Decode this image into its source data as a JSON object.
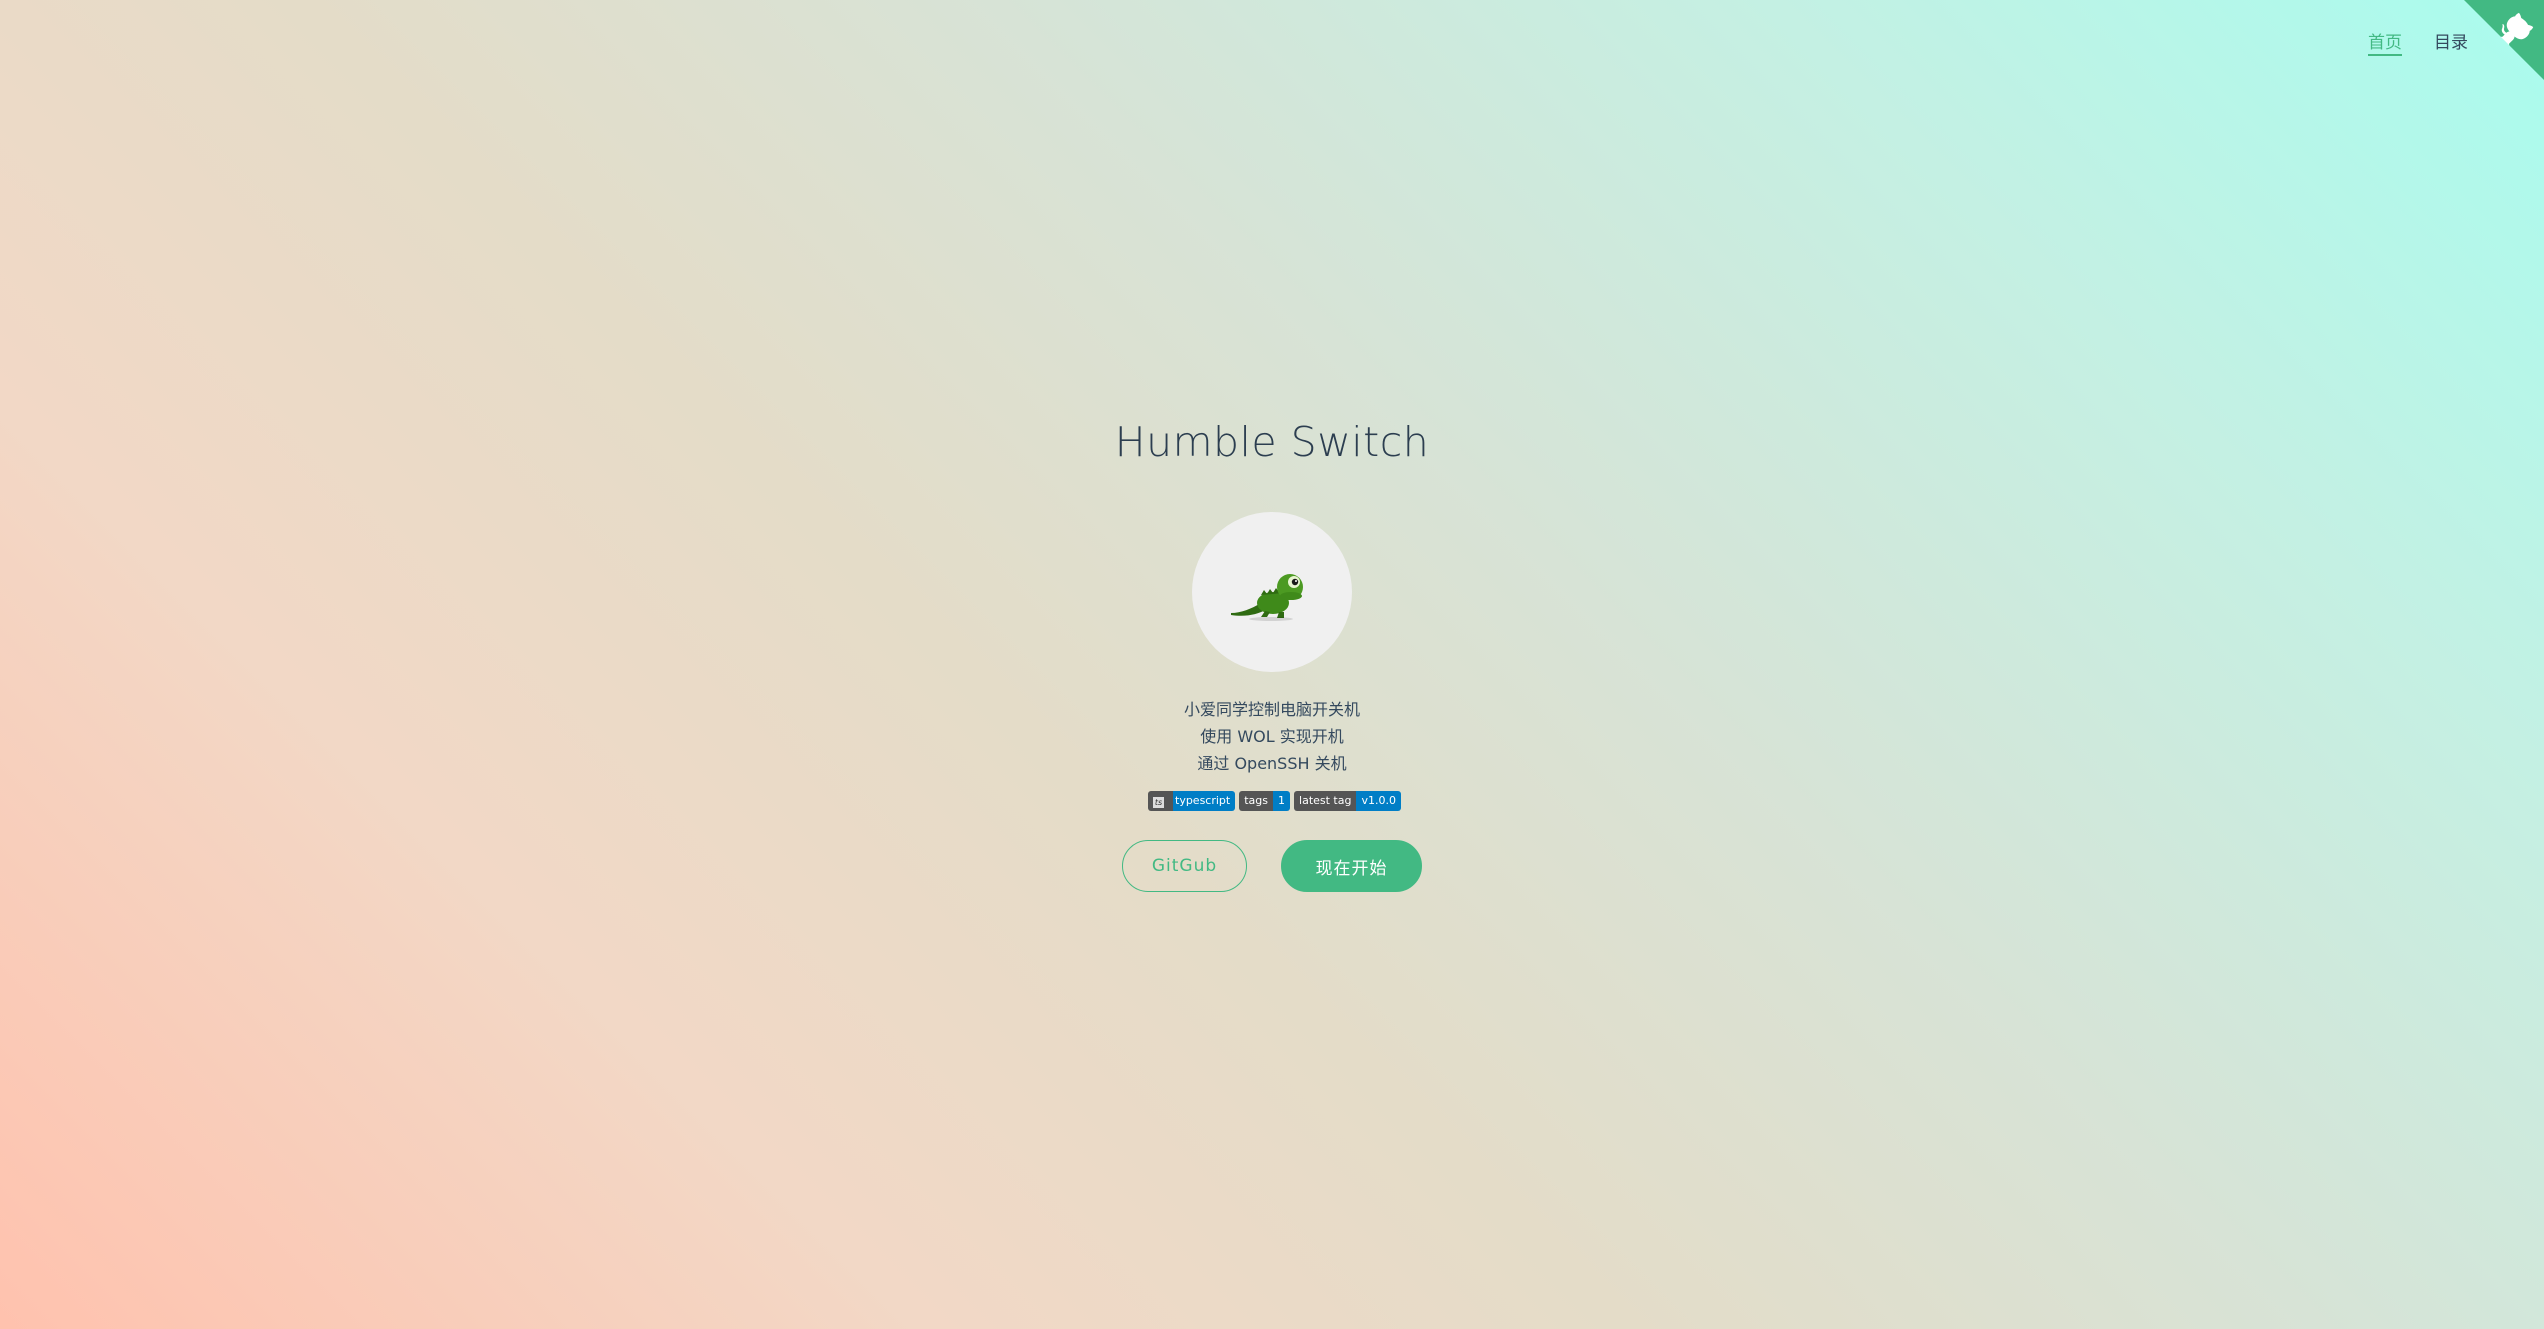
{
  "nav": {
    "items": [
      {
        "label": "首页",
        "active": true
      },
      {
        "label": "目录",
        "active": false
      }
    ]
  },
  "cover": {
    "title": "Humble Switch",
    "description": [
      "小爱同学控制电脑开关机",
      "使用 WOL 实现开机",
      "通过 OpenSSH 关机"
    ],
    "badges": [
      {
        "left": "",
        "right": "typescript",
        "left_icon": "typescript-icon"
      },
      {
        "left": "tags",
        "right": "1"
      },
      {
        "left": "latest tag",
        "right": "v1.0.0"
      }
    ],
    "buttons": {
      "secondary": "GitGub",
      "primary": "现在开始"
    }
  },
  "colors": {
    "accent": "#42b983",
    "text": "#34495e",
    "corner": "#42b983"
  },
  "icons": {
    "corner": "github-corner-icon",
    "logo": "lizard-logo"
  }
}
